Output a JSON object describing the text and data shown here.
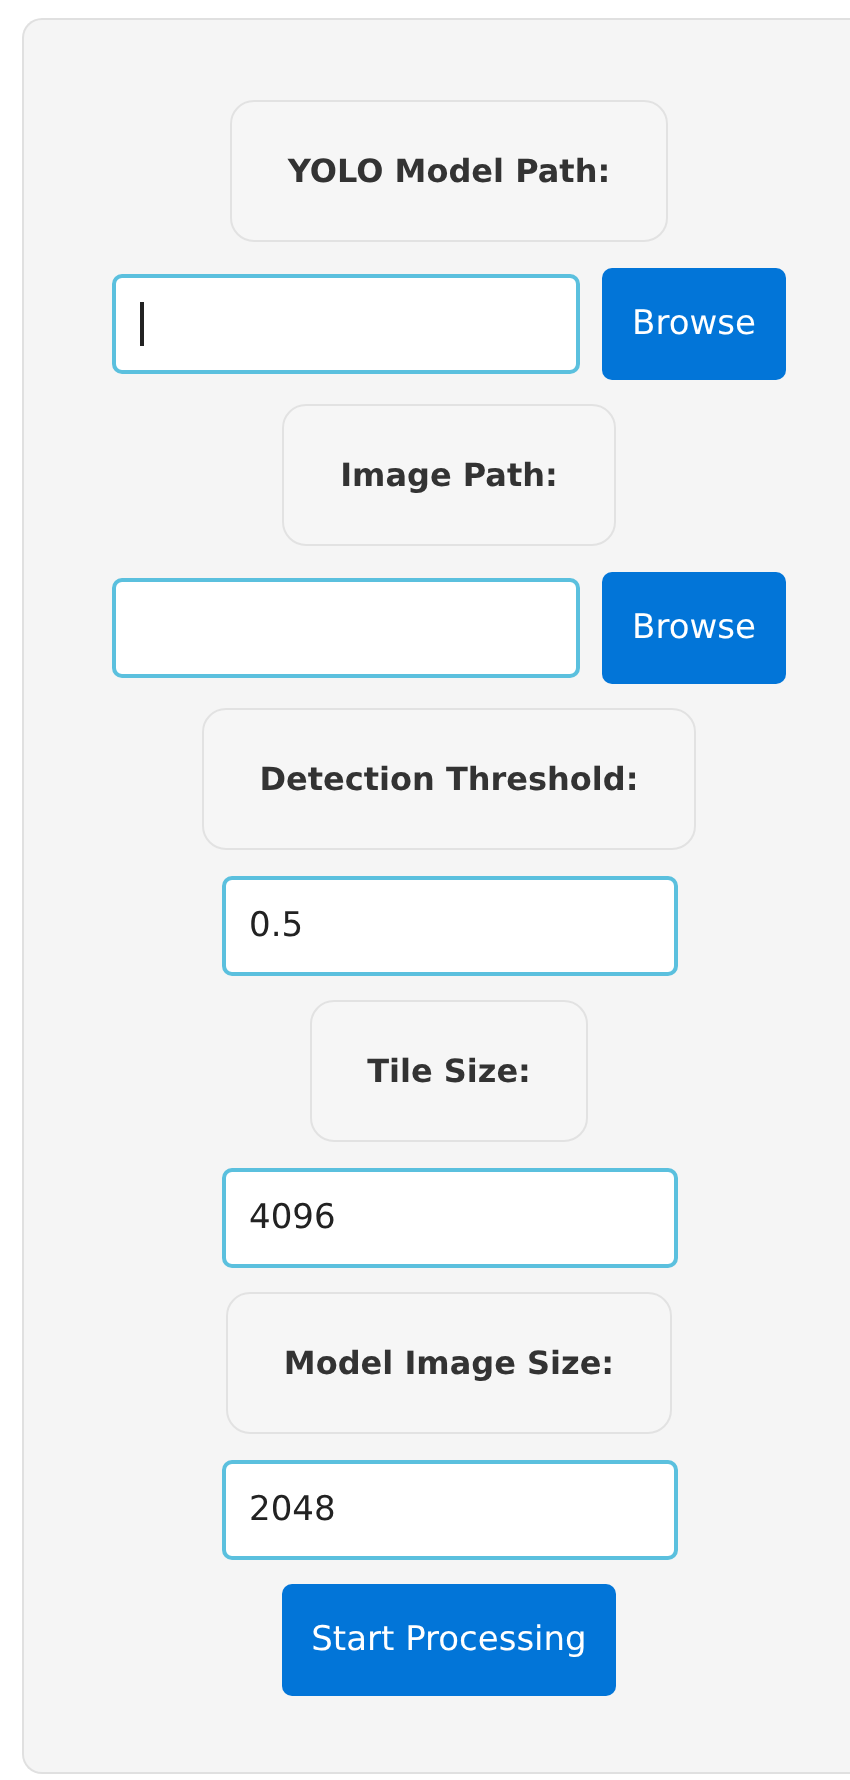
{
  "fields": [
    {
      "kind": "file",
      "label": "YOLO Model Path:",
      "focused": true,
      "button": "Browse"
    },
    {
      "kind": "file",
      "label": "Image Path:",
      "focused": false,
      "button": "Browse"
    },
    {
      "kind": "number",
      "label": "Detection Threshold:",
      "value": "0.5",
      "focused": false
    },
    {
      "kind": "number",
      "label": "Tile Size:",
      "value": "4096",
      "focused": false
    },
    {
      "kind": "number",
      "label": "Model Image Size:",
      "value": "2048",
      "focused": false
    }
  ],
  "submit": "Start Processing"
}
